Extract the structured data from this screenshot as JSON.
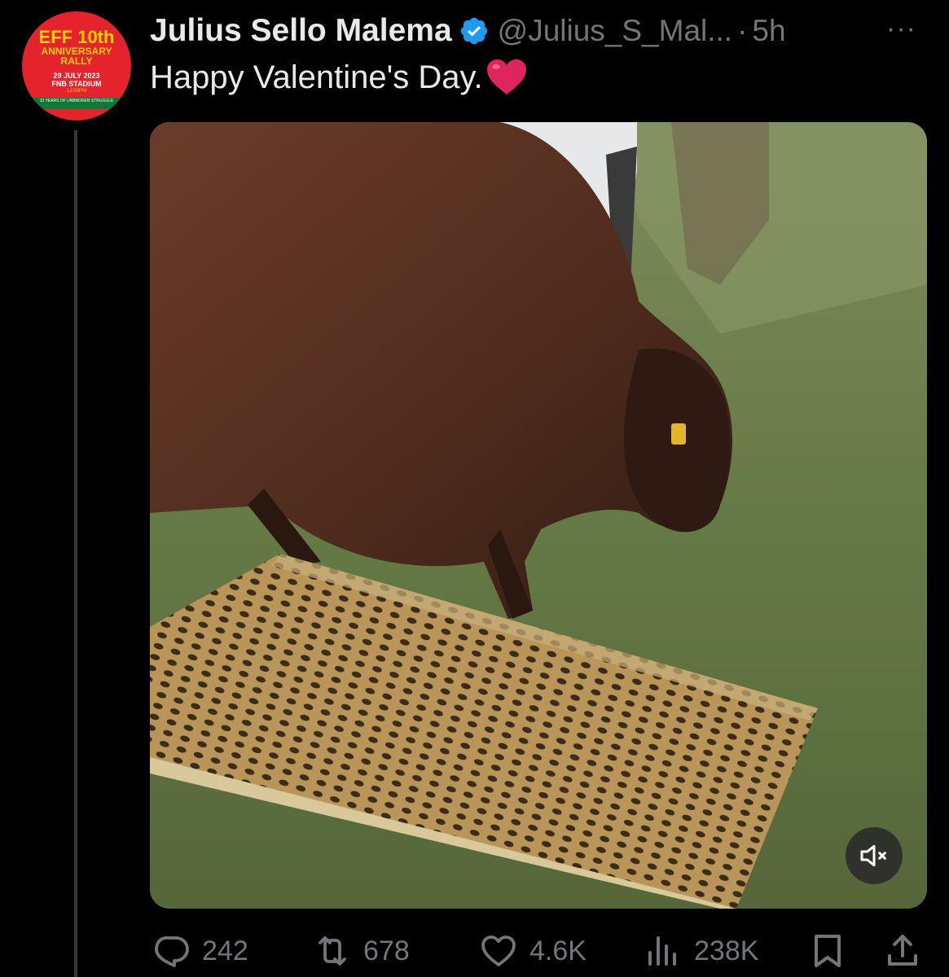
{
  "avatar": {
    "line1": "EFF 10th",
    "line2": "ANNIVERSARY",
    "line3": "RALLY",
    "line4": "29 JULY 2023",
    "line5": "FNB STADIUM",
    "line6": "12:00PM",
    "band": "10 YEARS OF UNBROKEN STRUGGLE"
  },
  "header": {
    "name": "Julius Sello Malema",
    "handle": "@Julius_S_Mal...",
    "separator": "·",
    "time": "5h",
    "more": "···"
  },
  "tweet": {
    "text": "Happy Valentine's Day."
  },
  "actions": {
    "replies": "242",
    "reposts": "678",
    "likes": "4.6K",
    "views": "238K"
  },
  "colors": {
    "background": "#000000",
    "text": "#e7e9ea",
    "muted": "#71767b",
    "verified": "#1d9bf0",
    "heart": "#e0245e"
  },
  "icons": [
    "verified-badge-icon",
    "more-icon",
    "heart-emoji-icon",
    "mute-icon",
    "reply-icon",
    "repost-icon",
    "like-icon",
    "views-icon",
    "bookmark-icon",
    "share-icon"
  ]
}
